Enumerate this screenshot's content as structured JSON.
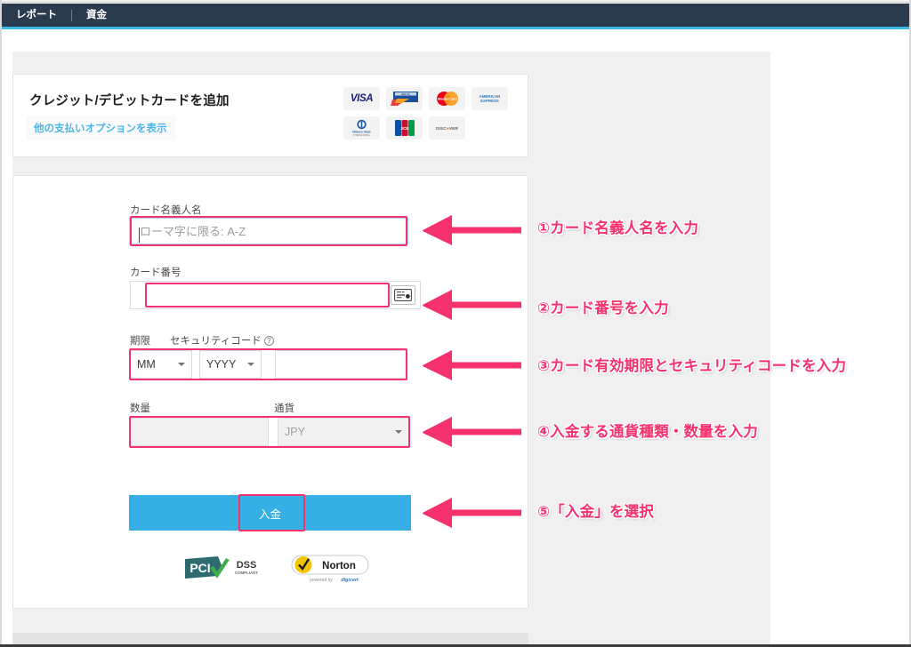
{
  "topbar": {
    "items": [
      {
        "label": "レポート",
        "name": "reports"
      },
      {
        "label": "資金",
        "name": "funds"
      }
    ]
  },
  "header_panel": {
    "title": "クレジット/デビットカードを追加",
    "alt_payment_button": "他の支払いオプションを表示",
    "card_brands": [
      {
        "name": "visa-logo",
        "label": "VISA"
      },
      {
        "name": "delta-logo",
        "label": "DELTA"
      },
      {
        "name": "mastercard-logo",
        "label": "MasterCard"
      },
      {
        "name": "amex-logo",
        "label": "AMERICAN EXPRESS"
      },
      {
        "name": "diners-club-logo",
        "label": "Diners Club INTERNATIONAL"
      },
      {
        "name": "jcb-logo",
        "label": "JCB"
      },
      {
        "name": "discover-logo",
        "label": "DISCOVER"
      }
    ]
  },
  "form": {
    "cardholder": {
      "label": "カード名義人名",
      "placeholder": "ローマ字に限る: A-Z",
      "value": ""
    },
    "card_number": {
      "label": "カード番号",
      "placeholder": "",
      "value": "",
      "icon": "credit-card-icon"
    },
    "expiry": {
      "label": "期限",
      "month": "MM",
      "year": "YYYY"
    },
    "security_code": {
      "label": "セキュリティコード",
      "help_icon": "question-mark-circle-icon",
      "value": ""
    },
    "amount": {
      "label": "数量",
      "value": ""
    },
    "currency": {
      "label": "通貨",
      "value": "JPY"
    },
    "submit_button": "入金"
  },
  "badges": [
    {
      "name": "pci-dss-badge",
      "line1": "PCI",
      "line2": "DSS",
      "line3": "COMPLIANT"
    },
    {
      "name": "norton-badge",
      "line1": "Norton",
      "line2": "powered by",
      "line3": "digicert"
    }
  ],
  "annotations": [
    {
      "name": "annotation-1",
      "text": "①カード名義人名を入力"
    },
    {
      "name": "annotation-2",
      "text": "②カード番号を入力"
    },
    {
      "name": "annotation-3",
      "text": "③カード有効期限とセキュリティコードを入力"
    },
    {
      "name": "annotation-4",
      "text": "④入金する通貨種類・数量を入力"
    },
    {
      "name": "annotation-5",
      "text": "⑤「入金」を選択"
    }
  ],
  "colors": {
    "accent_pink": "#f5316e",
    "topbar_navy": "#2b3b4e",
    "topbar_underline": "#3bb7e8",
    "button_blue": "#36b0e4",
    "link_blue": "#4db6e8"
  }
}
